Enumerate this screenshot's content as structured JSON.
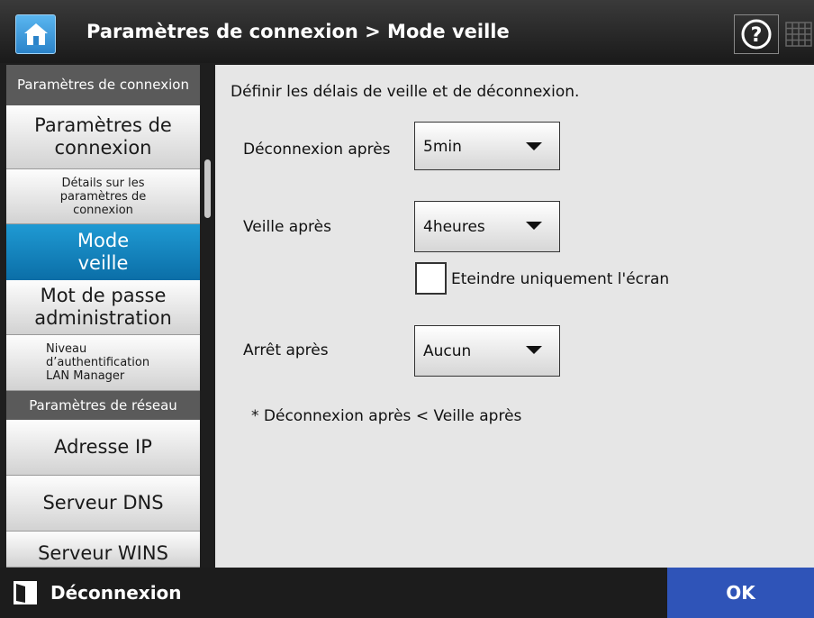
{
  "header": {
    "title": "Paramètres de connexion > Mode veille"
  },
  "sidebar": {
    "items": [
      {
        "label": "Paramètres de connexion",
        "type": "category"
      },
      {
        "label": "Paramètres de connexion",
        "type": "item"
      },
      {
        "label": "Détails sur les paramètres de connexion",
        "type": "item"
      },
      {
        "label": "Mode veille",
        "type": "item",
        "selected": true
      },
      {
        "label": "Mot de passe administration",
        "type": "item"
      },
      {
        "label": "Niveau d’authentification LAN Manager",
        "type": "item"
      },
      {
        "label": "Paramètres de réseau",
        "type": "category"
      },
      {
        "label": "Adresse IP",
        "type": "item"
      },
      {
        "label": "Serveur DNS",
        "type": "item"
      },
      {
        "label": "Serveur WINS",
        "type": "item"
      }
    ]
  },
  "main": {
    "intro": "Définir les délais de veille et de déconnexion.",
    "logout_after": {
      "label": "Déconnexion après",
      "value": "5min"
    },
    "sleep_after": {
      "label": "Veille après",
      "value": "4heures"
    },
    "screen_off_only": {
      "label": "Eteindre uniquement l'écran",
      "checked": false
    },
    "shutdown_after": {
      "label": "Arrêt après",
      "value": "Aucun"
    },
    "note": "* Déconnexion après < Veille après"
  },
  "footer": {
    "logout_label": "Déconnexion",
    "ok_label": "OK"
  },
  "colors": {
    "accent_selected": "#0b82c3",
    "ok_button": "#2f54b8"
  },
  "icons": [
    "home-icon",
    "help-icon",
    "keyboard-icon",
    "logout-icon",
    "dropdown-arrow-icon"
  ]
}
